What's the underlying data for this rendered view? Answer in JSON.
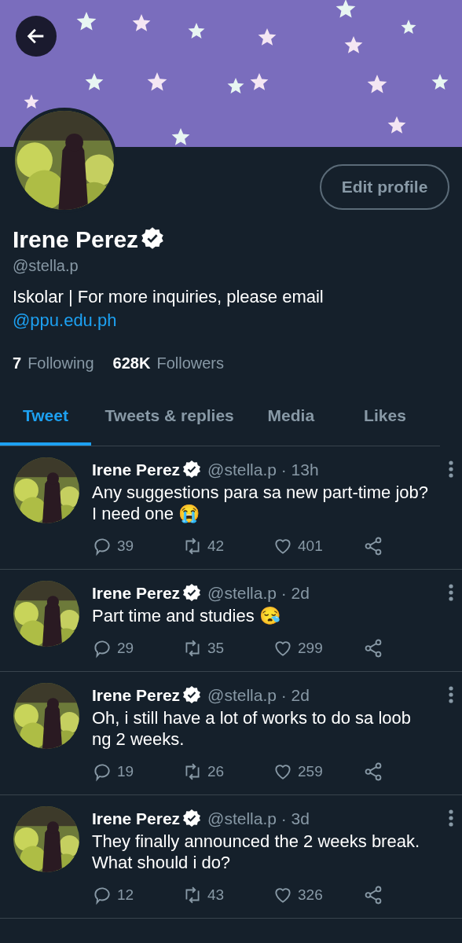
{
  "header": {
    "back": true
  },
  "profile": {
    "name": "Irene Perez",
    "verified": true,
    "handle": "@stella.p",
    "edit_button": "Edit profile",
    "bio": "Iskolar | For more inquiries, please email",
    "bio_link": "@ppu.edu.ph",
    "stats": [
      {
        "count": "7",
        "label": "Following"
      },
      {
        "count": "628K",
        "label": "Followers"
      }
    ]
  },
  "tabs": [
    {
      "label": "Tweet",
      "selected": true
    },
    {
      "label": "Tweets & replies",
      "selected": false
    },
    {
      "label": "Media",
      "selected": false
    },
    {
      "label": "Likes",
      "selected": false
    }
  ],
  "tweets": [
    {
      "name": "Irene Perez",
      "verified": true,
      "meta": "@stella.p · 13h",
      "text": "Any suggestions para sa new part-time job? I need one 😭",
      "replies": "39",
      "retweets": "42",
      "likes": "401"
    },
    {
      "name": "Irene Perez",
      "verified": true,
      "meta": "@stella.p · 2d",
      "text": "Part time and studies 😪",
      "replies": "29",
      "retweets": "35",
      "likes": "299"
    },
    {
      "name": "Irene Perez",
      "verified": true,
      "meta": "@stella.p · 2d",
      "text": "Oh, i still have a lot of works to do sa loob ng 2 weeks.",
      "replies": "19",
      "retweets": "26",
      "likes": "259"
    },
    {
      "name": "Irene Perez",
      "verified": true,
      "meta": "@stella.p · 3d",
      "text": "They finally announced the 2 weeks break. What should i do?",
      "replies": "12",
      "retweets": "43",
      "likes": "326"
    }
  ]
}
